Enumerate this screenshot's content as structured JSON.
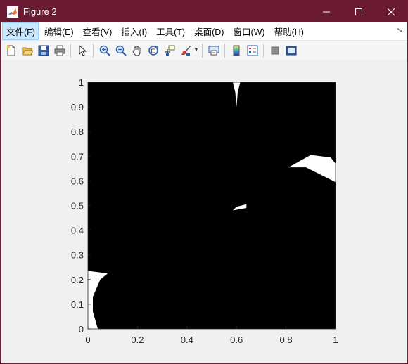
{
  "window": {
    "title": "Figure 2",
    "titlebar_color": "#6b1a33"
  },
  "menu": {
    "items": [
      "文件(F)",
      "编辑(E)",
      "查看(V)",
      "插入(I)",
      "工具(T)",
      "桌面(D)",
      "窗口(W)",
      "帮助(H)"
    ],
    "overflow_icon": "dock-arrow-icon"
  },
  "toolbar": {
    "icons": [
      "new-figure-icon",
      "open-file-icon",
      "save-icon",
      "print-icon",
      "edit-plot-arrow-icon",
      "zoom-in-icon",
      "zoom-out-icon",
      "pan-hand-icon",
      "rotate-3d-icon",
      "data-cursor-icon",
      "brush-icon",
      "link-plot-icon",
      "colorbar-icon",
      "legend-icon",
      "hide-plot-tools-icon",
      "show-plot-tools-icon"
    ]
  },
  "chart_data": {
    "type": "heatmap",
    "title": "",
    "xlabel": "",
    "ylabel": "",
    "xlim": [
      0,
      1
    ],
    "ylim": [
      0,
      1
    ],
    "x_ticks": [
      "0",
      "0.2",
      "0.4",
      "0.6",
      "0.8",
      "1"
    ],
    "y_ticks": [
      "0",
      "0.1",
      "0.2",
      "0.3",
      "0.4",
      "0.5",
      "0.6",
      "0.7",
      "0.8",
      "0.9",
      "1"
    ],
    "background_color": "#000000",
    "foreground_color": "#ffffff",
    "white_regions": [
      {
        "x": [
          0.585,
          0.595,
          0.6,
          0.605,
          0.615,
          0.6,
          0.585
        ],
        "y": [
          1.0,
          0.96,
          0.9,
          0.96,
          1.0,
          1.0,
          1.0
        ]
      },
      {
        "x": [
          0.81,
          0.9,
          0.98,
          1.0,
          1.0,
          0.94,
          0.88,
          0.81
        ],
        "y": [
          0.655,
          0.705,
          0.695,
          0.67,
          0.595,
          0.625,
          0.655,
          0.655
        ]
      },
      {
        "x": [
          0.585,
          0.64,
          0.64,
          0.6,
          0.585
        ],
        "y": [
          0.48,
          0.49,
          0.505,
          0.495,
          0.48
        ]
      },
      {
        "x": [
          0.0,
          0.08,
          0.05,
          0.02,
          0.02,
          0.04,
          0.03,
          0.0
        ],
        "y": [
          0.235,
          0.225,
          0.2,
          0.13,
          0.07,
          0.0,
          0.0,
          0.0
        ]
      }
    ]
  }
}
